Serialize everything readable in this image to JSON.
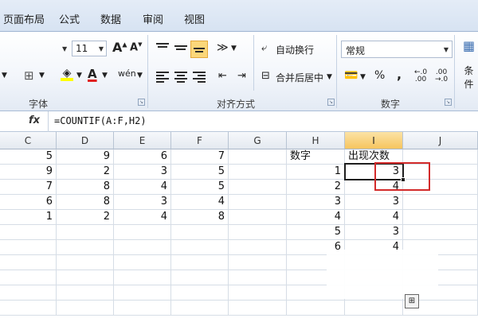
{
  "tabs": [
    "页面布局",
    "公式",
    "数据",
    "审阅",
    "视图"
  ],
  "ribbon": {
    "font_size": "11",
    "font_group_label": "字体",
    "align_group_label": "对齐方式",
    "number_group_label": "数字",
    "wrap_text": "自动换行",
    "merge_center": "合并后居中",
    "number_format": "常规",
    "conditional_label": "条件",
    "percent": "%",
    "comma": ",",
    "grow_font": "A",
    "shrink_font": "A",
    "font_color": "A",
    "wen_button": "wén"
  },
  "formula_bar": {
    "fx": "fx",
    "formula": "=COUNTIF(A:F,H2)"
  },
  "columns": [
    "C",
    "D",
    "E",
    "F",
    "G",
    "H",
    "I",
    "J"
  ],
  "rows": [
    [
      "5",
      "9",
      "6",
      "7",
      "",
      "数字",
      "出现次数",
      ""
    ],
    [
      "9",
      "2",
      "3",
      "5",
      "",
      "1",
      "3",
      ""
    ],
    [
      "7",
      "8",
      "4",
      "5",
      "",
      "2",
      "4",
      ""
    ],
    [
      "6",
      "8",
      "3",
      "4",
      "",
      "3",
      "3",
      ""
    ],
    [
      "1",
      "2",
      "4",
      "8",
      "",
      "4",
      "4",
      ""
    ],
    [
      "",
      "",
      "",
      "",
      "",
      "5",
      "3",
      ""
    ],
    [
      "",
      "",
      "",
      "",
      "",
      "6",
      "4",
      ""
    ]
  ],
  "colors": {
    "highlight_box": "#d22a2a",
    "active_header": "#f6c55e",
    "ribbon_bg": "#f3f6fb"
  }
}
